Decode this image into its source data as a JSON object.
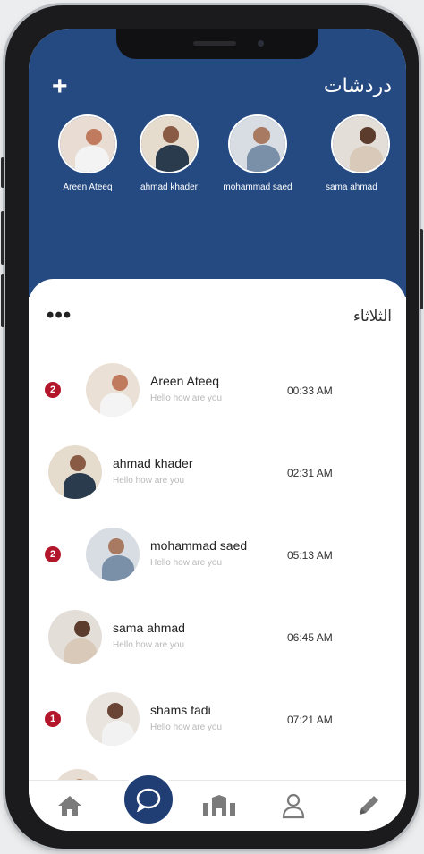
{
  "header": {
    "title": "دردشات",
    "add_label": "+"
  },
  "stories": [
    {
      "name": "Areen Ateeq"
    },
    {
      "name": "ahmad khader"
    },
    {
      "name": "mohammad  saed"
    },
    {
      "name": "sama ahmad"
    }
  ],
  "section": {
    "day_label": "الثلاثاء",
    "menu_label": "•••"
  },
  "chats": [
    {
      "name": "Areen Ateeq",
      "message": "Hello how are you",
      "time": "00:33 AM",
      "unread": "2"
    },
    {
      "name": "ahmad khader",
      "message": "Hello how are you",
      "time": "02:31 AM",
      "unread": ""
    },
    {
      "name": "mohammad  saed",
      "message": "Hello how are you",
      "time": "05:13 AM",
      "unread": "2"
    },
    {
      "name": "sama ahmad",
      "message": "Hello how are you",
      "time": "06:45 AM",
      "unread": ""
    },
    {
      "name": "shams fadi",
      "message": "Hello how are you",
      "time": "07:21 AM",
      "unread": "1"
    }
  ],
  "nav": {
    "items": [
      {
        "icon": "home-icon"
      },
      {
        "icon": "chat-icon",
        "active": true
      },
      {
        "icon": "building-icon"
      },
      {
        "icon": "user-icon"
      },
      {
        "icon": "pencil-icon"
      }
    ]
  },
  "colors": {
    "header_bg": "#254a82",
    "badge": "#b3152b",
    "nav_active": "#203e73"
  }
}
